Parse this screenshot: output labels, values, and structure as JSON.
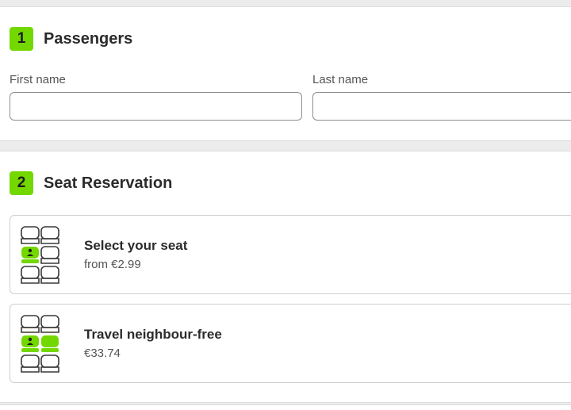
{
  "passengers": {
    "step_number": "1",
    "title": "Passengers",
    "first_name_label": "First name",
    "first_name_value": "",
    "last_name_label": "Last name",
    "last_name_value": ""
  },
  "seat_reservation": {
    "step_number": "2",
    "title": "Seat Reservation",
    "options": [
      {
        "title": "Select your seat",
        "price": "from €2.99",
        "icon": "single-seat-icon"
      },
      {
        "title": "Travel neighbour-free",
        "price": "€33.74",
        "icon": "neighbour-free-seat-icon"
      }
    ]
  },
  "colors": {
    "accent": "#73d700",
    "seat_outline": "#3a3a3a",
    "card_border": "#cfcfcf"
  }
}
